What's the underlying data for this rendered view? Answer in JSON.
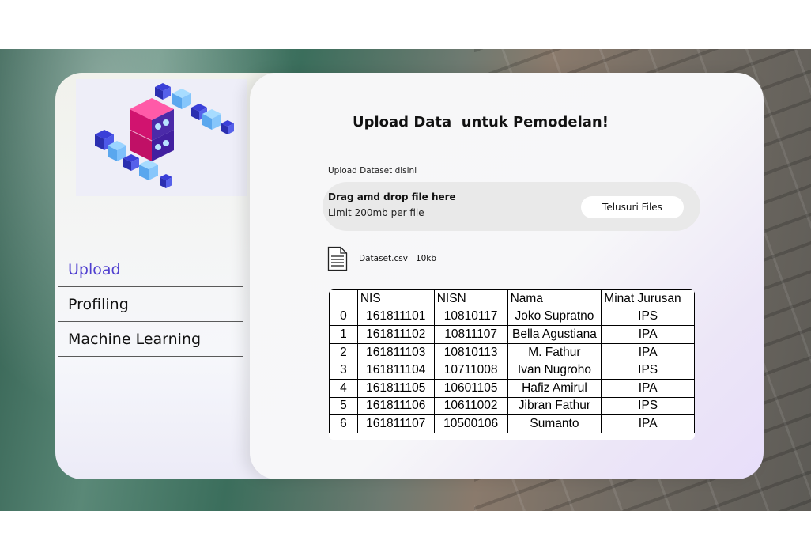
{
  "sidebar": {
    "illustration_icon": "isometric-server-blocks",
    "nav": [
      {
        "label": "Upload",
        "active": true
      },
      {
        "label": "Profiling",
        "active": false
      },
      {
        "label": "Machine Learning",
        "active": false
      }
    ],
    "active_color": "#4f3fd0"
  },
  "main": {
    "title": "Upload Data  untuk Pemodelan!",
    "upload_label": "Upload Dataset disini",
    "dropzone": {
      "title": "Drag amd drop file here",
      "limit": "Limit 200mb per file",
      "browse_label": "Telusuri Files"
    },
    "file": {
      "icon": "document-icon",
      "name": "Dataset.csv",
      "size": "10kb"
    },
    "table": {
      "columns": [
        "",
        "NIS",
        "NISN",
        "Nama",
        "Minat Jurusan"
      ],
      "rows": [
        [
          "0",
          "161811101",
          "10810117",
          "Joko Supratno",
          "IPS"
        ],
        [
          "1",
          "161811102",
          "10811107",
          "Bella Agustiana",
          "IPA"
        ],
        [
          "2",
          "161811103",
          "10810113",
          "M. Fathur",
          "IPA"
        ],
        [
          "3",
          "161811104",
          "10711008",
          "Ivan Nugroho",
          "IPS"
        ],
        [
          "4",
          "161811105",
          "10601105",
          "Hafiz Amirul",
          "IPA"
        ],
        [
          "5",
          "161811106",
          "10611002",
          "Jibran Fathur",
          "IPS"
        ],
        [
          "6",
          "161811107",
          "10500106",
          "Sumanto",
          "IPA"
        ]
      ]
    }
  }
}
